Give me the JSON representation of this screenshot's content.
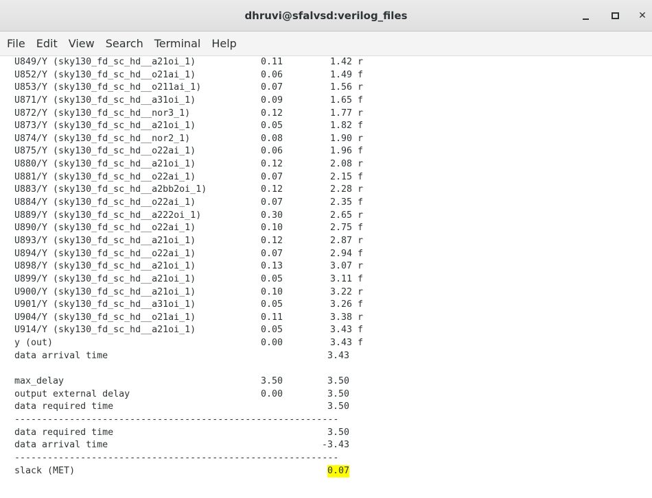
{
  "window": {
    "title": "dhruvi@sfalvsd:verilog_files",
    "min_label": "_",
    "max_label": "",
    "close_label": "✕"
  },
  "menu": [
    "File",
    "Edit",
    "View",
    "Search",
    "Terminal",
    "Help"
  ],
  "terminal": {
    "cell_rows": [
      [
        "  U849/Y (sky130_fd_sc_hd__a21oi_1)",
        "0.11",
        "1.42 r"
      ],
      [
        "  U852/Y (sky130_fd_sc_hd__o21ai_1)",
        "0.06",
        "1.49 f"
      ],
      [
        "  U853/Y (sky130_fd_sc_hd__o211ai_1)",
        "0.07",
        "1.56 r"
      ],
      [
        "  U871/Y (sky130_fd_sc_hd__a31oi_1)",
        "0.09",
        "1.65 f"
      ],
      [
        "  U872/Y (sky130_fd_sc_hd__nor3_1)",
        "0.12",
        "1.77 r"
      ],
      [
        "  U873/Y (sky130_fd_sc_hd__a21oi_1)",
        "0.05",
        "1.82 f"
      ],
      [
        "  U874/Y (sky130_fd_sc_hd__nor2_1)",
        "0.08",
        "1.90 r"
      ],
      [
        "  U875/Y (sky130_fd_sc_hd__o22ai_1)",
        "0.06",
        "1.96 f"
      ],
      [
        "  U880/Y (sky130_fd_sc_hd__a21oi_1)",
        "0.12",
        "2.08 r"
      ],
      [
        "  U881/Y (sky130_fd_sc_hd__o22ai_1)",
        "0.07",
        "2.15 f"
      ],
      [
        "  U883/Y (sky130_fd_sc_hd__a2bb2oi_1)",
        "0.12",
        "2.28 r"
      ],
      [
        "  U884/Y (sky130_fd_sc_hd__o22ai_1)",
        "0.07",
        "2.35 f"
      ],
      [
        "  U889/Y (sky130_fd_sc_hd__a222oi_1)",
        "0.30",
        "2.65 r"
      ],
      [
        "  U890/Y (sky130_fd_sc_hd__o22ai_1)",
        "0.10",
        "2.75 f"
      ],
      [
        "  U893/Y (sky130_fd_sc_hd__a21oi_1)",
        "0.12",
        "2.87 r"
      ],
      [
        "  U894/Y (sky130_fd_sc_hd__o22ai_1)",
        "0.07",
        "2.94 f"
      ],
      [
        "  U898/Y (sky130_fd_sc_hd__a21oi_1)",
        "0.13",
        "3.07 r"
      ],
      [
        "  U899/Y (sky130_fd_sc_hd__a21oi_1)",
        "0.05",
        "3.11 f"
      ],
      [
        "  U900/Y (sky130_fd_sc_hd__a21oi_1)",
        "0.10",
        "3.22 r"
      ],
      [
        "  U901/Y (sky130_fd_sc_hd__a31oi_1)",
        "0.05",
        "3.26 f"
      ],
      [
        "  U904/Y (sky130_fd_sc_hd__o21ai_1)",
        "0.11",
        "3.38 r"
      ],
      [
        "  U914/Y (sky130_fd_sc_hd__a21oi_1)",
        "0.05",
        "3.43 f"
      ],
      [
        "  y (out)",
        "0.00",
        "3.43 f"
      ],
      [
        "  data arrival time",
        "",
        "3.43"
      ],
      [
        "",
        "",
        ""
      ],
      [
        "  max_delay",
        "3.50",
        "3.50"
      ],
      [
        "  output external delay",
        "0.00",
        "3.50"
      ],
      [
        "  data required time",
        "",
        "3.50"
      ],
      [
        "  -----------------------------------------------------------",
        "",
        ""
      ],
      [
        "  data required time",
        "",
        "3.50"
      ],
      [
        "  data arrival time",
        "",
        "-3.43"
      ],
      [
        "  -----------------------------------------------------------",
        "",
        ""
      ],
      [
        "  slack (MET)",
        "",
        "0.07"
      ]
    ],
    "highlight_value": "0.07",
    "highlight_color": "#ffff00"
  }
}
